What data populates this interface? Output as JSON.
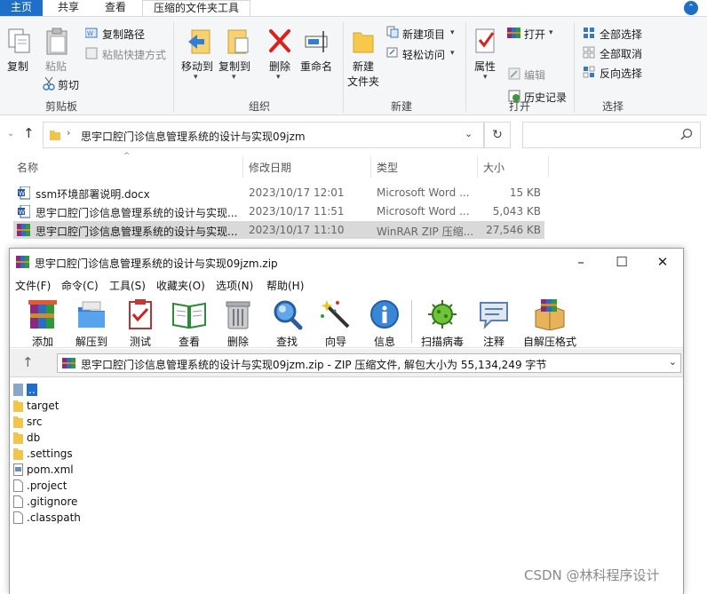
{
  "explorer": {
    "tabs": [
      "主页",
      "共享",
      "查看",
      "压缩的文件夹工具"
    ],
    "ribbon": {
      "clipboard": {
        "copy": "复制",
        "paste": "粘贴",
        "copy_path": "复制路径",
        "paste_shortcut": "粘贴快捷方式",
        "cut": "剪切",
        "group": "剪贴板"
      },
      "organize": {
        "move_to": "移动到",
        "copy_to": "复制到",
        "delete": "删除",
        "rename": "重命名",
        "group": "组织"
      },
      "new": {
        "new_folder_line1": "新建",
        "new_folder_line2": "文件夹",
        "new_item": "新建项目",
        "easy_access": "轻松访问",
        "group": "新建"
      },
      "open": {
        "properties": "属性",
        "open": "打开",
        "edit": "编辑",
        "history": "历史记录",
        "group": "打开"
      },
      "select": {
        "select_all": "全部选择",
        "select_none": "全部取消",
        "invert": "反向选择",
        "group": "选择"
      }
    },
    "address": "思宇口腔门诊信息管理系统的设计与实现09jzm",
    "columns": {
      "name": "名称",
      "date": "修改日期",
      "type": "类型",
      "size": "大小"
    },
    "files": [
      {
        "name": "ssm环境部署说明.docx",
        "date": "2023/10/17 12:01",
        "type": "Microsoft Word ...",
        "size": "15 KB",
        "icon": "word-icon",
        "selected": false
      },
      {
        "name": "思宇口腔门诊信息管理系统的设计与实现...",
        "date": "2023/10/17 11:51",
        "type": "Microsoft Word ...",
        "size": "5,043 KB",
        "icon": "word-icon",
        "selected": false
      },
      {
        "name": "思宇口腔门诊信息管理系统的设计与实现...",
        "date": "2023/10/17 11:10",
        "type": "WinRAR ZIP 压缩...",
        "size": "27,546 KB",
        "icon": "winrar-icon",
        "selected": true
      }
    ]
  },
  "winrar": {
    "title": "思宇口腔门诊信息管理系统的设计与实现09jzm.zip",
    "menu": [
      "文件(F)",
      "命令(C)",
      "工具(S)",
      "收藏夹(O)",
      "选项(N)",
      "帮助(H)"
    ],
    "tools": [
      {
        "label": "添加",
        "icon": "add-icon"
      },
      {
        "label": "解压到",
        "icon": "extract-to-icon"
      },
      {
        "label": "测试",
        "icon": "test-icon"
      },
      {
        "label": "查看",
        "icon": "view-icon"
      },
      {
        "label": "删除",
        "icon": "delete-icon"
      },
      {
        "label": "查找",
        "icon": "find-icon"
      },
      {
        "label": "向导",
        "icon": "wizard-icon"
      },
      {
        "label": "信息",
        "icon": "info-icon"
      },
      {
        "label": "扫描病毒",
        "icon": "virus-scan-icon"
      },
      {
        "label": "注释",
        "icon": "comment-icon"
      },
      {
        "label": "自解压格式",
        "icon": "sfx-icon"
      }
    ],
    "address": "思宇口腔门诊信息管理系统的设计与实现09jzm.zip - ZIP 压缩文件, 解包大小为 55,134,249 字节",
    "entries": [
      {
        "name": "..",
        "kind": "parent"
      },
      {
        "name": "target",
        "kind": "folder"
      },
      {
        "name": "src",
        "kind": "folder"
      },
      {
        "name": "db",
        "kind": "folder"
      },
      {
        "name": ".settings",
        "kind": "folder"
      },
      {
        "name": "pom.xml",
        "kind": "xml"
      },
      {
        "name": ".project",
        "kind": "file"
      },
      {
        "name": ".gitignore",
        "kind": "file"
      },
      {
        "name": ".classpath",
        "kind": "file"
      }
    ]
  },
  "watermark": "CSDN @林科程序设计",
  "colors": {
    "accent": "#1f6fc9",
    "selected_row": "#d9d9d9",
    "folder": "#f3c44c"
  }
}
